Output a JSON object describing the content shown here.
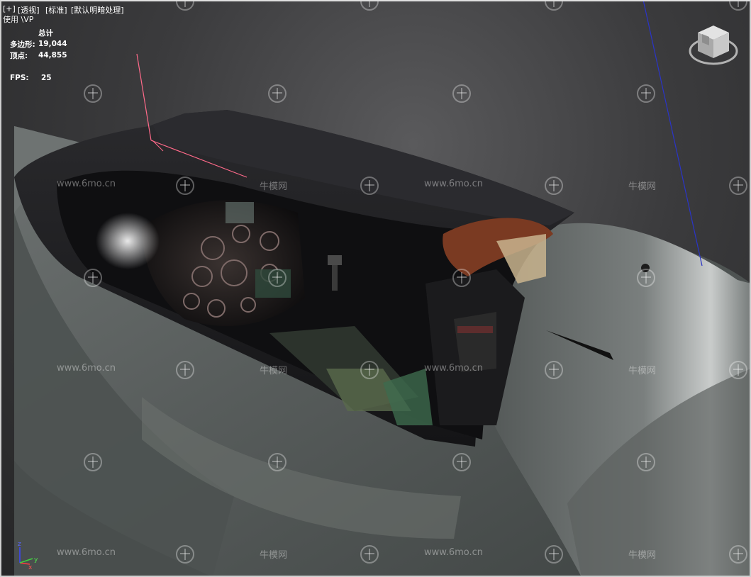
{
  "viewport": {
    "menu": [
      {
        "label": "[+]"
      },
      {
        "label": "[透视]"
      },
      {
        "label": "[标准]"
      },
      {
        "label": "[默认明暗处理]"
      }
    ],
    "renderer_label": "使用 \\VP",
    "stats": {
      "header": "总计",
      "polygons_label": "多边形:",
      "polygons_value": "19,044",
      "vertices_label": "顶点:",
      "vertices_value": "44,855",
      "fps_label": "FPS:",
      "fps_value": "25"
    },
    "axis_labels": {
      "z": "z",
      "x": "x",
      "y": "y"
    }
  },
  "watermark": {
    "site_text": "www.6mo.cn",
    "brand_text": "牛模网"
  },
  "colors": {
    "fuselage": "#5f6463",
    "canopy_frame": "#1a1a1c",
    "axis_x": "#ff6a8a",
    "axis_y": "#2a34c8",
    "background": "#3b3b3d"
  }
}
